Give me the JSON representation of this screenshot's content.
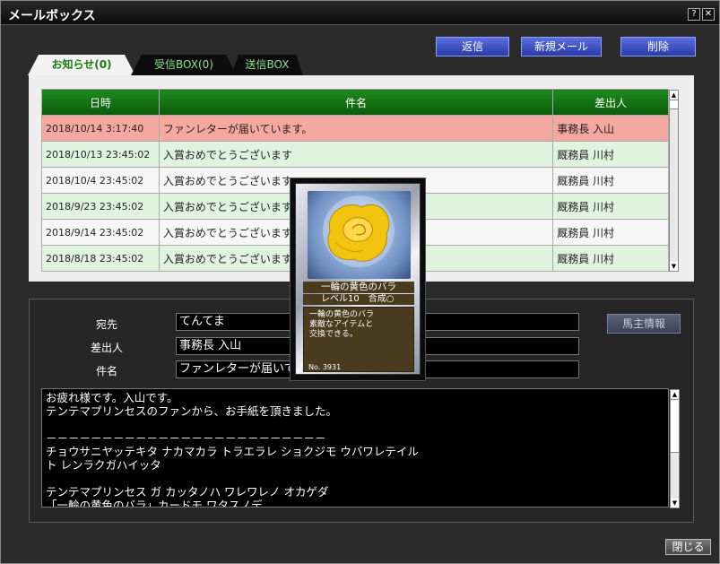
{
  "window": {
    "title": "メールボックス",
    "help_label": "?",
    "close_label": "✕"
  },
  "toolbar": {
    "reply_label": "返信",
    "new_mail_label": "新規メール",
    "delete_label": "削除"
  },
  "tabs": [
    {
      "label": "お知らせ(0)"
    },
    {
      "label": "受信BOX(0)"
    },
    {
      "label": "送信BOX"
    }
  ],
  "list": {
    "headers": {
      "date": "日時",
      "subject": "件名",
      "sender": "差出人"
    },
    "rows": [
      {
        "date": "2018/10/14 3:17:40",
        "subject": "ファンレターが届いています。",
        "sender": "事務長 入山"
      },
      {
        "date": "2018/10/13 23:45:02",
        "subject": "入賞おめでとうございます",
        "sender": "厩務員 川村"
      },
      {
        "date": "2018/10/4 23:45:02",
        "subject": "入賞おめでとうございます",
        "sender": "厩務員 川村"
      },
      {
        "date": "2018/9/23 23:45:02",
        "subject": "入賞おめでとうございます",
        "sender": "厩務員 川村"
      },
      {
        "date": "2018/9/14 23:45:02",
        "subject": "入賞おめでとうございます",
        "sender": "厩務員 川村"
      },
      {
        "date": "2018/8/18 23:45:02",
        "subject": "入賞おめでとうございます",
        "sender": "厩務員 川村"
      }
    ]
  },
  "detail": {
    "to_label": "宛先",
    "to_value": "てんてま",
    "from_label": "差出人",
    "from_value": "事務長 入山",
    "subject_label": "件名",
    "subject_value": "ファンレターが届いて",
    "horse_info_label": "馬主情報",
    "body": "お疲れ様です。入山です。\nテンテマプリンセスのファンから、お手紙を頂きました。\n\n－－－－－－－－－－－－－－－－－－－－－－－－－\nチョウサニヤッテキタ ナカマカラ トラエラレ ショクジモ ウバワレテイル\nト レンラクガハイッタ\n\nテンテマプリンセス ガ カッタノハ ワレワレノ オカゲダ\n「一輪の黄色のバラ」カードモ ワタスノデ"
  },
  "card": {
    "name": "一輪の黄色のバラ",
    "level": "レベル10　合成○",
    "description": "一輪の黄色のバラ\n素敵なアイテムと\n交換できる。",
    "number": "No. 3931"
  },
  "footer": {
    "close_label": "閉じる"
  }
}
